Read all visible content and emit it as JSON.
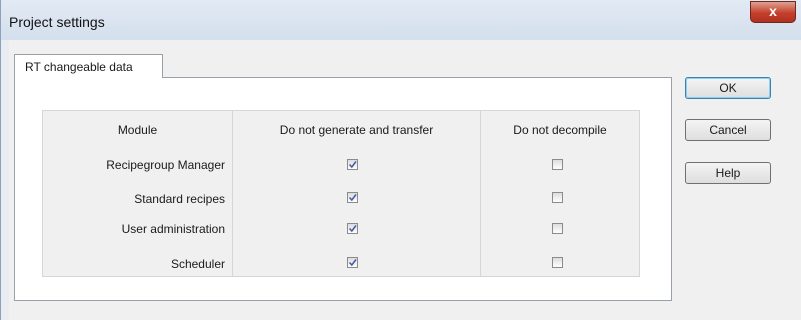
{
  "window": {
    "title": "Project settings",
    "close_symbol": "x"
  },
  "tabs": [
    {
      "label": "RT changeable data",
      "active": true
    }
  ],
  "table": {
    "headers": [
      "Module",
      "Do not generate and transfer",
      "Do not decompile"
    ],
    "rows": [
      {
        "module": "Recipegroup Manager",
        "no_generate": true,
        "no_decompile": false
      },
      {
        "module": "Standard recipes",
        "no_generate": true,
        "no_decompile": false
      },
      {
        "module": "User administration",
        "no_generate": true,
        "no_decompile": false
      },
      {
        "module": "Scheduler",
        "no_generate": true,
        "no_decompile": false
      }
    ]
  },
  "buttons": {
    "ok": "OK",
    "cancel": "Cancel",
    "help": "Help"
  },
  "colors": {
    "check_mark": "#4a5ea8",
    "default_button_border": "#3c7fb1"
  },
  "icons": {
    "close": "close-icon",
    "checkmark": "checkmark-icon"
  }
}
